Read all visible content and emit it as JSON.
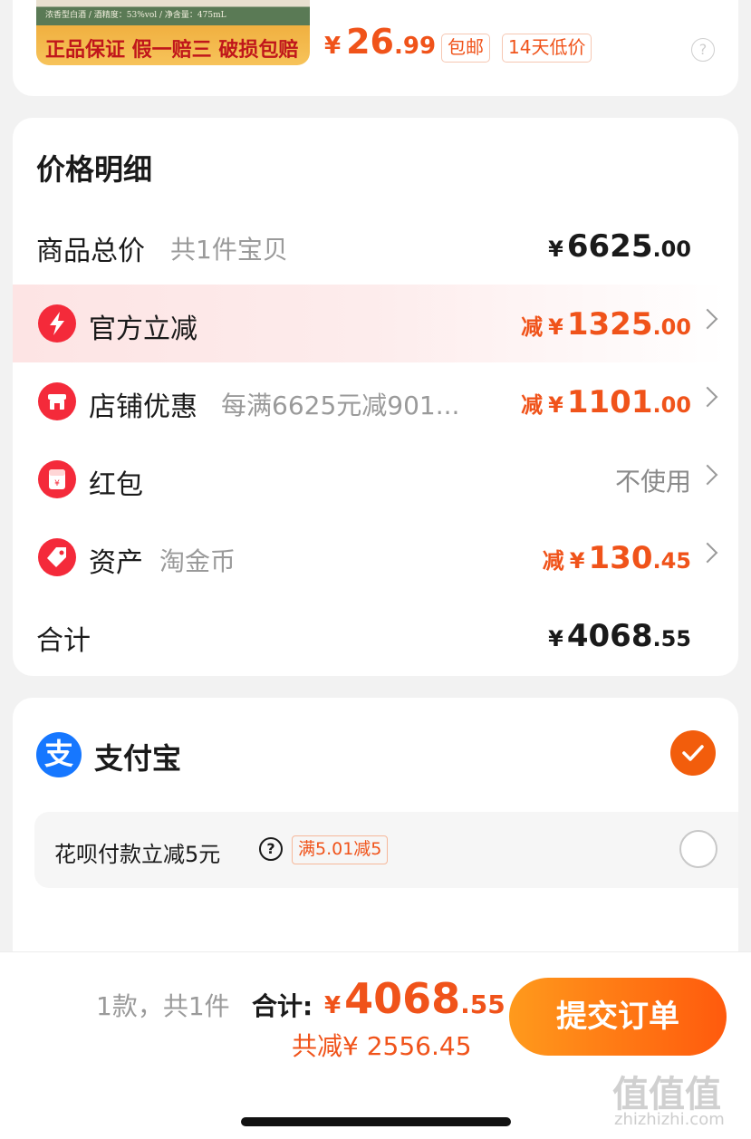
{
  "product": {
    "spec_text": "浓香型白酒 / 酒精度：53%vol / 净含量：475mL",
    "guarantee_text": "正品保证 假一赔三 破损包赔",
    "price_currency": "¥",
    "price_integer": "26",
    "price_decimal": ".99",
    "tags": [
      "包邮",
      "14天低价"
    ],
    "help_glyph": "?"
  },
  "price_detail": {
    "title": "价格明细",
    "goods_total": {
      "label": "商品总价",
      "sub": "共1件宝贝",
      "currency": "¥",
      "integer": "6625",
      "decimal": ".00"
    },
    "official_discount": {
      "label": "官方立减",
      "prefix": "减",
      "currency": "¥",
      "integer": "1325",
      "decimal": ".00"
    },
    "store_discount": {
      "label": "店铺优惠",
      "sub": "每满6625元减901...",
      "prefix": "减",
      "currency": "¥",
      "integer": "1101",
      "decimal": ".00"
    },
    "red_packet": {
      "label": "红包",
      "value": "不使用"
    },
    "assets": {
      "label": "资产",
      "sub": "淘金币",
      "prefix": "减",
      "currency": "¥",
      "integer": "130",
      "decimal": ".45"
    },
    "total": {
      "label": "合计",
      "currency": "¥",
      "integer": "4068",
      "decimal": ".55"
    }
  },
  "payment": {
    "alipay_glyph": "支",
    "alipay_label": "支付宝",
    "alipay_selected": true,
    "huabei_label": "花呗付款立减5元",
    "huabei_help": "?",
    "huabei_tag": "满5.01减5",
    "huabei_selected": false
  },
  "bottom_bar": {
    "count_text": "1款，共1件",
    "total_label": "合计:",
    "total_currency": "¥",
    "total_integer": "4068",
    "total_decimal": ".55",
    "saved_text": "共减¥ 2556.45",
    "submit_label": "提交订单"
  },
  "watermark": {
    "text": "值值值",
    "url": "zhizhizhi.com"
  },
  "colors": {
    "accent": "#f0531a",
    "red_icon": "#f42a3a",
    "alipay_blue": "#1677ff"
  }
}
